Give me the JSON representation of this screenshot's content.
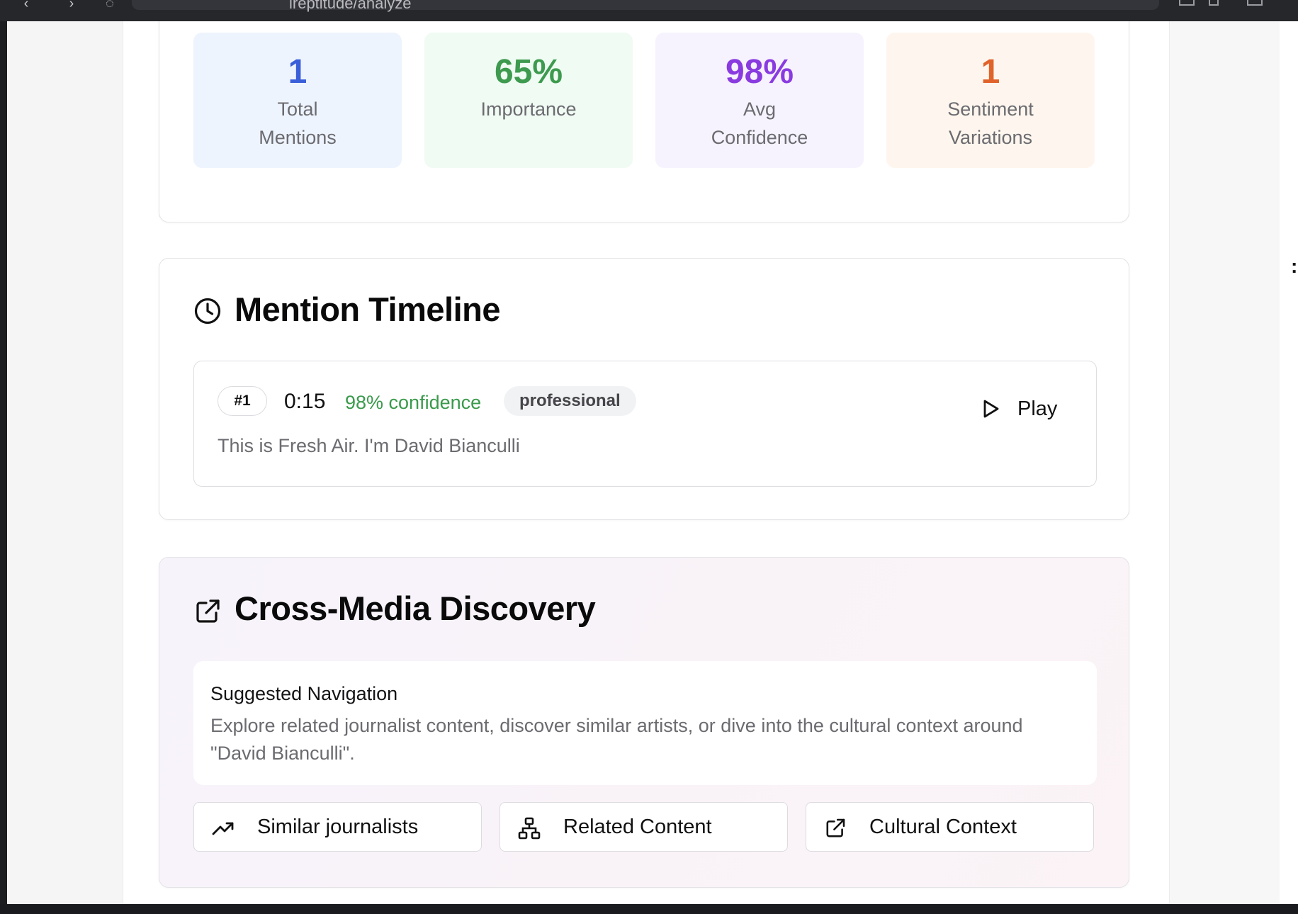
{
  "browser": {
    "url": "ireptitude/analyze"
  },
  "stats": [
    {
      "value": "1",
      "label": "Total Mentions",
      "color": "#3a5fd9",
      "bg": "#eef4fe"
    },
    {
      "value": "65%",
      "label": "Importance",
      "color": "#3d9a4e",
      "bg": "#f0fbf3"
    },
    {
      "value": "98%",
      "label": "Avg Confidence",
      "color": "#8a3be0",
      "bg": "#f6f3fe"
    },
    {
      "value": "1",
      "label": "Sentiment Variations",
      "color": "#e0632b",
      "bg": "#fef6ee"
    }
  ],
  "timeline": {
    "title": "Mention Timeline",
    "icon": "clock-icon",
    "mentions": [
      {
        "index": "#1",
        "time": "0:15",
        "confidence": "98% confidence",
        "tag": "professional",
        "quote": "This is Fresh Air. I'm David Bianculli",
        "play_label": "Play"
      }
    ]
  },
  "discovery": {
    "title": "Cross-Media Discovery",
    "icon": "external-link-icon",
    "nav_heading": "Suggested Navigation",
    "nav_description": "Explore related journalist content, discover similar artists, or dive into the cultural context around \"David Bianculli\".",
    "actions": [
      {
        "label": "Similar journalists",
        "icon": "trending-up-icon"
      },
      {
        "label": "Related Content",
        "icon": "network-icon"
      },
      {
        "label": "Cultural Context",
        "icon": "external-link-icon"
      }
    ]
  }
}
